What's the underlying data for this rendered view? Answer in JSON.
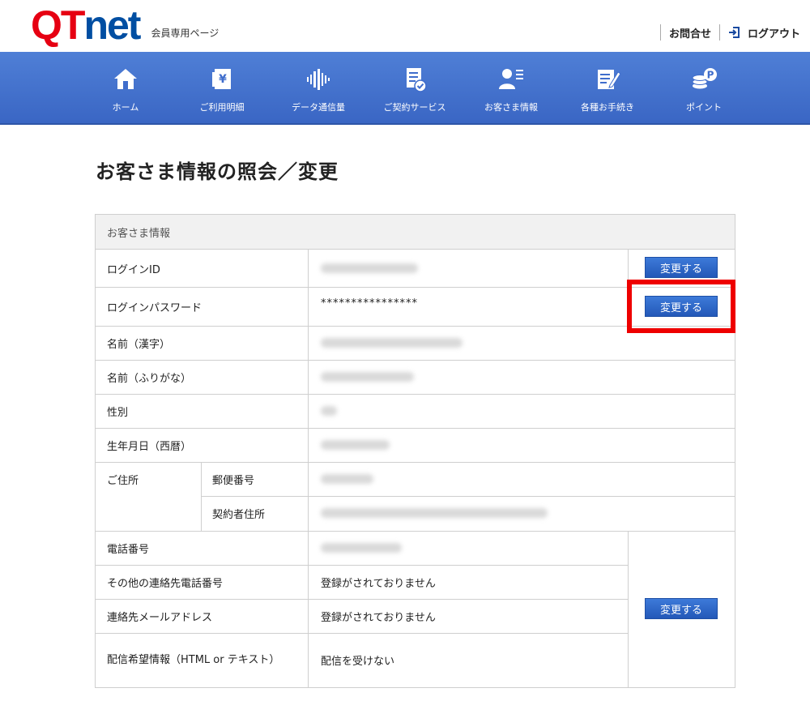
{
  "header": {
    "logo_q": "Q",
    "logo_t": "T",
    "logo_net": "net",
    "subtitle": "会員専用ページ",
    "contact_link": "お問合せ",
    "logout_link": "ログアウト"
  },
  "nav": {
    "items": [
      {
        "label": "ホーム",
        "icon": "home-icon"
      },
      {
        "label": "ご利用明細",
        "icon": "billing-icon"
      },
      {
        "label": "データ通信量",
        "icon": "data-usage-icon"
      },
      {
        "label": "ご契約サービス",
        "icon": "contract-icon"
      },
      {
        "label": "お客さま情報",
        "icon": "user-info-icon"
      },
      {
        "label": "各種お手続き",
        "icon": "procedure-icon"
      },
      {
        "label": "ポイント",
        "icon": "points-icon"
      }
    ]
  },
  "page": {
    "title": "お客さま情報の照会／変更"
  },
  "table": {
    "section_title": "お客さま情報",
    "change_label": "変更する",
    "rows": {
      "login_id": {
        "label": "ログインID"
      },
      "password": {
        "label": "ログインパスワード",
        "value": "****************"
      },
      "name_kanji": {
        "label": "名前（漢字）"
      },
      "name_kana": {
        "label": "名前（ふりがな）"
      },
      "gender": {
        "label": "性別"
      },
      "birthday": {
        "label": "生年月日（西暦）"
      },
      "address": {
        "label": "ご住所",
        "postal_label": "郵便番号",
        "contract_address_label": "契約者住所"
      },
      "phone": {
        "label": "電話番号"
      },
      "other_phone": {
        "label": "その他の連絡先電話番号",
        "value": "登録がされておりません"
      },
      "email": {
        "label": "連絡先メールアドレス",
        "value": "登録がされておりません"
      },
      "delivery": {
        "label": "配信希望情報（HTML or テキスト）",
        "value": "配信を受けない"
      }
    }
  },
  "colors": {
    "brand_red": "#e60012",
    "brand_blue": "#004ea2",
    "nav_blue": "#3a66c4",
    "button_blue": "#2358b8",
    "highlight_red": "#ee0000"
  }
}
